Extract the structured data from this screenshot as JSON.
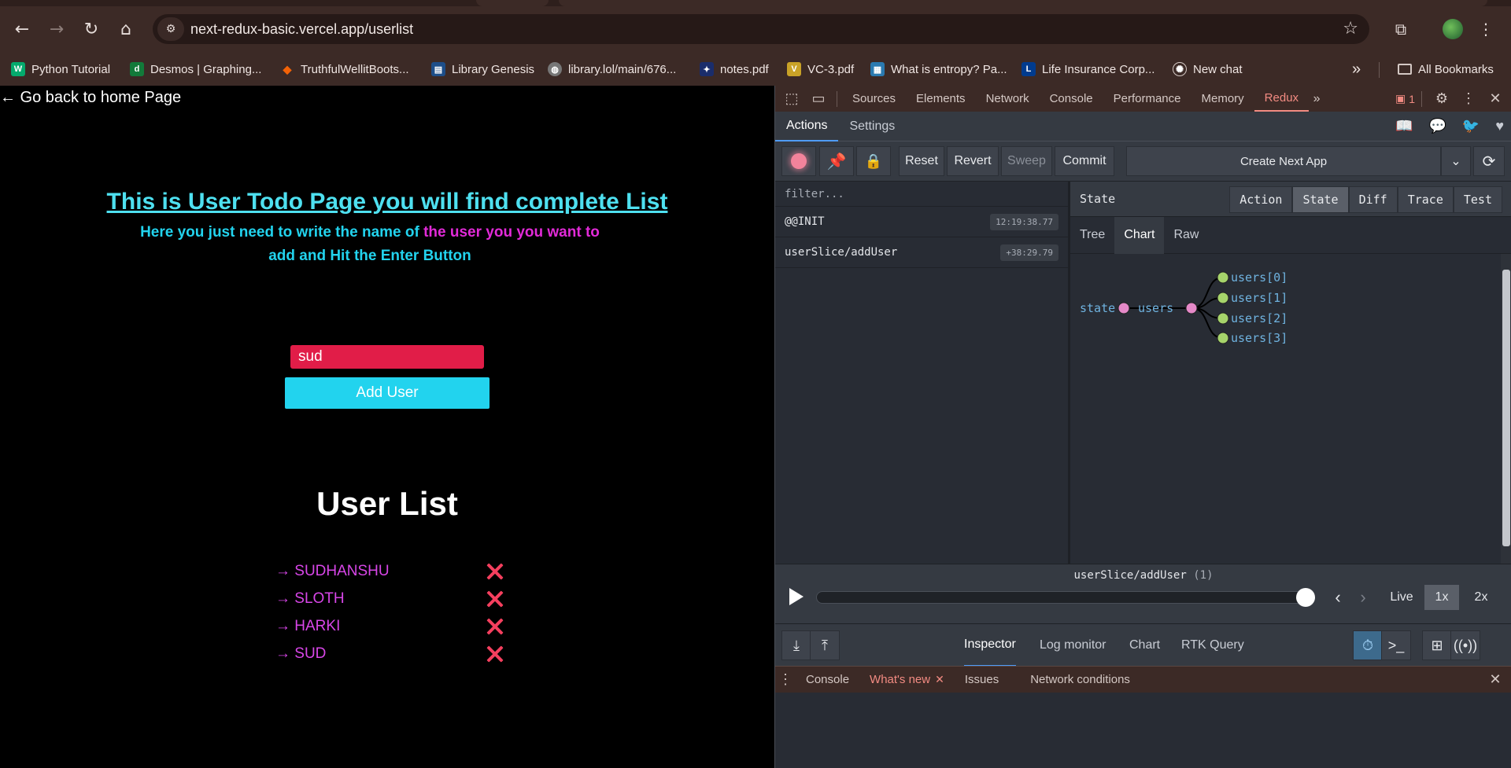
{
  "browser": {
    "url": "next-redux-basic.vercel.app/userlist",
    "bookmarks": [
      {
        "label": "Python Tutorial",
        "icon": "W",
        "color": "#04aa6d"
      },
      {
        "label": "Desmos | Graphing...",
        "icon": "d",
        "color": "#127a3a"
      },
      {
        "label": "TruthfulWellitBoots...",
        "icon": "◆",
        "color": "#f26207"
      },
      {
        "label": "Library Genesis",
        "icon": "▤",
        "color": "#1d4e89"
      },
      {
        "label": "library.lol/main/676...",
        "icon": "◍",
        "color": "#777777"
      },
      {
        "label": "notes.pdf",
        "icon": "✦",
        "color": "#1a2d6b"
      },
      {
        "label": "VC-3.pdf",
        "icon": "V",
        "color": "#c9a227"
      },
      {
        "label": "What is entropy? Pa...",
        "icon": "▦",
        "color": "#2a7ab0"
      },
      {
        "label": "Life Insurance Corp...",
        "icon": "L",
        "color": "#003b8e"
      },
      {
        "label": "New chat",
        "icon": "✺",
        "color": "#3c2a26"
      }
    ],
    "all_bookmarks": "All Bookmarks"
  },
  "page": {
    "back_link": "← Go back to home Page",
    "title": "This is User Todo Page you will find complete List",
    "subtitle_part1": "Here you just need to write the name of ",
    "subtitle_part2": "the user you you want to",
    "subtitle_part3": "add and Hit the Enter Button",
    "input_value": "sud",
    "add_button": "Add User",
    "list_heading": "User List",
    "users": [
      "→ SUDHANSHU",
      "→ SLOTH",
      "→ HARKI",
      "→ SUD"
    ],
    "colors": {
      "accent_cyan": "#22d3ee",
      "accent_pink": "#e22ad8",
      "input_red": "#e11d48"
    }
  },
  "devtools": {
    "tabs": [
      "Sources",
      "Elements",
      "Network",
      "Console",
      "Performance",
      "Memory",
      "Redux"
    ],
    "active_tab": "Redux",
    "issues_count": "1",
    "redux": {
      "top_tabs": [
        "Actions",
        "Settings"
      ],
      "toolbar": {
        "reset": "Reset",
        "revert": "Revert",
        "sweep": "Sweep",
        "commit": "Commit"
      },
      "instance": "Create Next App",
      "filter_placeholder": "filter...",
      "actions": [
        {
          "name": "@@INIT",
          "time": "12:19:38.77"
        },
        {
          "name": "userSlice/addUser",
          "time": "+38:29.79"
        }
      ],
      "state_label": "State",
      "mode_tabs": [
        "Action",
        "State",
        "Diff",
        "Trace",
        "Test"
      ],
      "view_tabs": [
        "Tree",
        "Chart",
        "Raw"
      ],
      "chart": {
        "root": "state",
        "child": "users",
        "leaves": [
          "users[0]",
          "users[1]",
          "users[2]",
          "users[3]"
        ]
      },
      "slider_label": "userSlice/addUser",
      "slider_count": "(1)",
      "slider_position": 1.0,
      "speed": {
        "live": "Live",
        "x1": "1x",
        "x2": "2x"
      },
      "monitors": [
        "Inspector",
        "Log monitor",
        "Chart",
        "RTK Query"
      ]
    },
    "drawer_tabs": [
      "Console",
      "What's new",
      "Issues",
      "Network conditions"
    ]
  }
}
